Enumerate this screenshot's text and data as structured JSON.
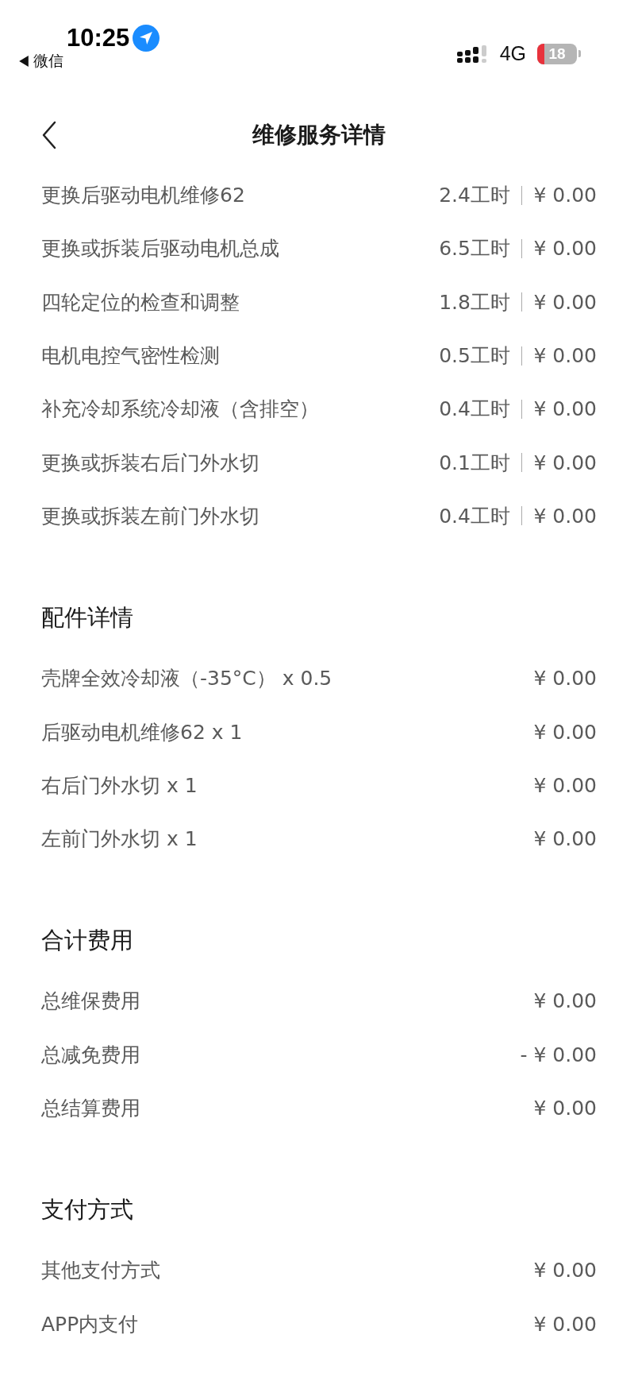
{
  "status_bar": {
    "time": "10:25",
    "back_app": "微信",
    "network": "4G",
    "battery": "18"
  },
  "nav": {
    "title": "维修服务详情"
  },
  "labor_items": [
    {
      "name": "更换后驱动电机维修62",
      "hours": "2.4工时",
      "price": "¥ 0.00"
    },
    {
      "name": "更换或拆装后驱动电机总成",
      "hours": "6.5工时",
      "price": "¥ 0.00"
    },
    {
      "name": "四轮定位的检查和调整",
      "hours": "1.8工时",
      "price": "¥ 0.00"
    },
    {
      "name": "电机电控气密性检测",
      "hours": "0.5工时",
      "price": "¥ 0.00"
    },
    {
      "name": "补充冷却系统冷却液（含排空）",
      "hours": "0.4工时",
      "price": "¥ 0.00"
    },
    {
      "name": "更换或拆装右后门外水切",
      "hours": "0.1工时",
      "price": "¥ 0.00"
    },
    {
      "name": "更换或拆装左前门外水切",
      "hours": "0.4工时",
      "price": "¥ 0.00"
    }
  ],
  "sections": [
    {
      "title": "配件详情",
      "rows": [
        {
          "label": "壳牌全效冷却液（-35°C） x 0.5",
          "value": "¥ 0.00"
        },
        {
          "label": "后驱动电机维修62 x 1",
          "value": "¥ 0.00"
        },
        {
          "label": "右后门外水切 x 1",
          "value": "¥ 0.00"
        },
        {
          "label": "左前门外水切 x 1",
          "value": "¥ 0.00"
        }
      ]
    },
    {
      "title": "合计费用",
      "rows": [
        {
          "label": "总维保费用",
          "value": "¥ 0.00"
        },
        {
          "label": "总减免费用",
          "value": "- ¥ 0.00"
        },
        {
          "label": "总结算费用",
          "value": "¥ 0.00"
        }
      ]
    },
    {
      "title": "支付方式",
      "rows": [
        {
          "label": "其他支付方式",
          "value": "¥ 0.00"
        },
        {
          "label": "APP内支付",
          "value": "¥ 0.00"
        }
      ]
    }
  ]
}
